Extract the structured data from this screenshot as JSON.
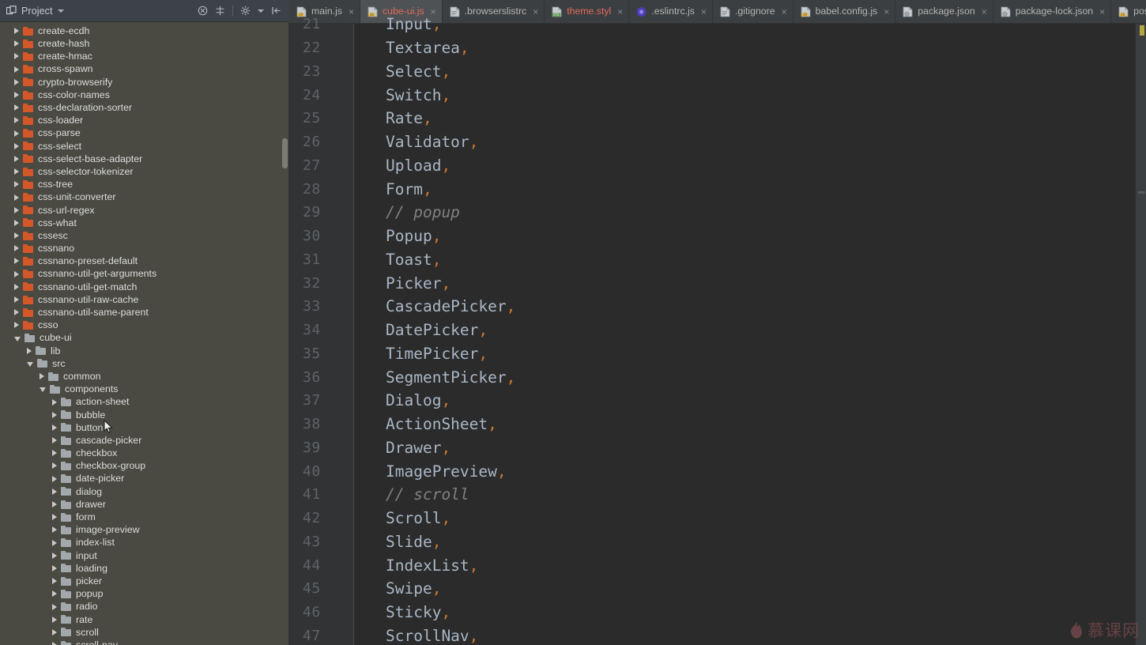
{
  "sidebar": {
    "panel_title": "Project",
    "panel_icon": "project-panel-icon",
    "header_icons": [
      {
        "name": "collapse-all-icon",
        "label": "Collapse All"
      },
      {
        "name": "locate-file-icon",
        "label": "Select Opened File"
      },
      {
        "name": "settings-gear-icon",
        "label": "Settings"
      },
      {
        "name": "hide-panel-icon",
        "label": "Hide"
      }
    ],
    "tree": [
      {
        "label": "create-ecdh",
        "indent": 1,
        "state": "closed",
        "color": "orange"
      },
      {
        "label": "create-hash",
        "indent": 1,
        "state": "closed",
        "color": "orange"
      },
      {
        "label": "create-hmac",
        "indent": 1,
        "state": "closed",
        "color": "orange"
      },
      {
        "label": "cross-spawn",
        "indent": 1,
        "state": "closed",
        "color": "orange"
      },
      {
        "label": "crypto-browserify",
        "indent": 1,
        "state": "closed",
        "color": "orange"
      },
      {
        "label": "css-color-names",
        "indent": 1,
        "state": "closed",
        "color": "orange"
      },
      {
        "label": "css-declaration-sorter",
        "indent": 1,
        "state": "closed",
        "color": "orange"
      },
      {
        "label": "css-loader",
        "indent": 1,
        "state": "closed",
        "color": "orange"
      },
      {
        "label": "css-parse",
        "indent": 1,
        "state": "closed",
        "color": "orange"
      },
      {
        "label": "css-select",
        "indent": 1,
        "state": "closed",
        "color": "orange"
      },
      {
        "label": "css-select-base-adapter",
        "indent": 1,
        "state": "closed",
        "color": "orange"
      },
      {
        "label": "css-selector-tokenizer",
        "indent": 1,
        "state": "closed",
        "color": "orange"
      },
      {
        "label": "css-tree",
        "indent": 1,
        "state": "closed",
        "color": "orange"
      },
      {
        "label": "css-unit-converter",
        "indent": 1,
        "state": "closed",
        "color": "orange"
      },
      {
        "label": "css-url-regex",
        "indent": 1,
        "state": "closed",
        "color": "orange"
      },
      {
        "label": "css-what",
        "indent": 1,
        "state": "closed",
        "color": "orange"
      },
      {
        "label": "cssesc",
        "indent": 1,
        "state": "closed",
        "color": "orange"
      },
      {
        "label": "cssnano",
        "indent": 1,
        "state": "closed",
        "color": "orange"
      },
      {
        "label": "cssnano-preset-default",
        "indent": 1,
        "state": "closed",
        "color": "orange"
      },
      {
        "label": "cssnano-util-get-arguments",
        "indent": 1,
        "state": "closed",
        "color": "orange"
      },
      {
        "label": "cssnano-util-get-match",
        "indent": 1,
        "state": "closed",
        "color": "orange"
      },
      {
        "label": "cssnano-util-raw-cache",
        "indent": 1,
        "state": "closed",
        "color": "orange"
      },
      {
        "label": "cssnano-util-same-parent",
        "indent": 1,
        "state": "closed",
        "color": "orange"
      },
      {
        "label": "csso",
        "indent": 1,
        "state": "closed",
        "color": "orange"
      },
      {
        "label": "cube-ui",
        "indent": 1,
        "state": "open",
        "color": "gray"
      },
      {
        "label": "lib",
        "indent": 2,
        "state": "closed",
        "color": "gray"
      },
      {
        "label": "src",
        "indent": 2,
        "state": "open",
        "color": "gray"
      },
      {
        "label": "common",
        "indent": 3,
        "state": "closed",
        "color": "gray"
      },
      {
        "label": "components",
        "indent": 3,
        "state": "open",
        "color": "gray"
      },
      {
        "label": "action-sheet",
        "indent": 4,
        "state": "closed",
        "color": "gray"
      },
      {
        "label": "bubble",
        "indent": 4,
        "state": "closed",
        "color": "gray"
      },
      {
        "label": "button",
        "indent": 4,
        "state": "closed",
        "color": "gray"
      },
      {
        "label": "cascade-picker",
        "indent": 4,
        "state": "closed",
        "color": "gray"
      },
      {
        "label": "checkbox",
        "indent": 4,
        "state": "closed",
        "color": "gray"
      },
      {
        "label": "checkbox-group",
        "indent": 4,
        "state": "closed",
        "color": "gray"
      },
      {
        "label": "date-picker",
        "indent": 4,
        "state": "closed",
        "color": "gray"
      },
      {
        "label": "dialog",
        "indent": 4,
        "state": "closed",
        "color": "gray"
      },
      {
        "label": "drawer",
        "indent": 4,
        "state": "closed",
        "color": "gray"
      },
      {
        "label": "form",
        "indent": 4,
        "state": "closed",
        "color": "gray"
      },
      {
        "label": "image-preview",
        "indent": 4,
        "state": "closed",
        "color": "gray"
      },
      {
        "label": "index-list",
        "indent": 4,
        "state": "closed",
        "color": "gray"
      },
      {
        "label": "input",
        "indent": 4,
        "state": "closed",
        "color": "gray"
      },
      {
        "label": "loading",
        "indent": 4,
        "state": "closed",
        "color": "gray"
      },
      {
        "label": "picker",
        "indent": 4,
        "state": "closed",
        "color": "gray"
      },
      {
        "label": "popup",
        "indent": 4,
        "state": "closed",
        "color": "gray"
      },
      {
        "label": "radio",
        "indent": 4,
        "state": "closed",
        "color": "gray"
      },
      {
        "label": "rate",
        "indent": 4,
        "state": "closed",
        "color": "gray"
      },
      {
        "label": "scroll",
        "indent": 4,
        "state": "closed",
        "color": "gray"
      },
      {
        "label": "scroll-nav",
        "indent": 4,
        "state": "closed",
        "color": "gray"
      }
    ]
  },
  "tabs": [
    {
      "label": "main.js",
      "icon": "js-file-icon",
      "active": false,
      "modified": false
    },
    {
      "label": "cube-ui.js",
      "icon": "js-file-icon",
      "active": true,
      "modified": true
    },
    {
      "label": ".browserslistrc",
      "icon": "plain-file-icon",
      "active": false,
      "modified": false
    },
    {
      "label": "theme.styl",
      "icon": "styl-file-icon",
      "active": false,
      "modified": true
    },
    {
      "label": ".eslintrc.js",
      "icon": "eslint-file-icon",
      "active": false,
      "modified": false
    },
    {
      "label": ".gitignore",
      "icon": "plain-file-icon",
      "active": false,
      "modified": false
    },
    {
      "label": "babel.config.js",
      "icon": "js-file-icon",
      "active": false,
      "modified": false
    },
    {
      "label": "package.json",
      "icon": "json-file-icon",
      "active": false,
      "modified": false
    },
    {
      "label": "package-lock.json",
      "icon": "json-file-icon",
      "active": false,
      "modified": false
    },
    {
      "label": "postcss.config.js",
      "icon": "js-file-icon",
      "active": false,
      "modified": false
    }
  ],
  "tab_close_glyph": "×",
  "editor": {
    "lines": [
      {
        "num": "21",
        "indent": "  ",
        "name": "Input",
        "punc": ",",
        "comment": null
      },
      {
        "num": "22",
        "indent": "  ",
        "name": "Textarea",
        "punc": ",",
        "comment": null
      },
      {
        "num": "23",
        "indent": "  ",
        "name": "Select",
        "punc": ",",
        "comment": null
      },
      {
        "num": "24",
        "indent": "  ",
        "name": "Switch",
        "punc": ",",
        "comment": null
      },
      {
        "num": "25",
        "indent": "  ",
        "name": "Rate",
        "punc": ",",
        "comment": null
      },
      {
        "num": "26",
        "indent": "  ",
        "name": "Validator",
        "punc": ",",
        "comment": null
      },
      {
        "num": "27",
        "indent": "  ",
        "name": "Upload",
        "punc": ",",
        "comment": null
      },
      {
        "num": "28",
        "indent": "  ",
        "name": "Form",
        "punc": ",",
        "comment": null
      },
      {
        "num": "29",
        "indent": "  ",
        "name": null,
        "punc": "",
        "comment": "// popup"
      },
      {
        "num": "30",
        "indent": "  ",
        "name": "Popup",
        "punc": ",",
        "comment": null
      },
      {
        "num": "31",
        "indent": "  ",
        "name": "Toast",
        "punc": ",",
        "comment": null
      },
      {
        "num": "32",
        "indent": "  ",
        "name": "Picker",
        "punc": ",",
        "comment": null
      },
      {
        "num": "33",
        "indent": "  ",
        "name": "CascadePicker",
        "punc": ",",
        "comment": null
      },
      {
        "num": "34",
        "indent": "  ",
        "name": "DatePicker",
        "punc": ",",
        "comment": null
      },
      {
        "num": "35",
        "indent": "  ",
        "name": "TimePicker",
        "punc": ",",
        "comment": null
      },
      {
        "num": "36",
        "indent": "  ",
        "name": "SegmentPicker",
        "punc": ",",
        "comment": null
      },
      {
        "num": "37",
        "indent": "  ",
        "name": "Dialog",
        "punc": ",",
        "comment": null
      },
      {
        "num": "38",
        "indent": "  ",
        "name": "ActionSheet",
        "punc": ",",
        "comment": null
      },
      {
        "num": "39",
        "indent": "  ",
        "name": "Drawer",
        "punc": ",",
        "comment": null
      },
      {
        "num": "40",
        "indent": "  ",
        "name": "ImagePreview",
        "punc": ",",
        "comment": null
      },
      {
        "num": "41",
        "indent": "  ",
        "name": null,
        "punc": "",
        "comment": "// scroll"
      },
      {
        "num": "42",
        "indent": "  ",
        "name": "Scroll",
        "punc": ",",
        "comment": null
      },
      {
        "num": "43",
        "indent": "  ",
        "name": "Slide",
        "punc": ",",
        "comment": null
      },
      {
        "num": "44",
        "indent": "  ",
        "name": "IndexList",
        "punc": ",",
        "comment": null
      },
      {
        "num": "45",
        "indent": "  ",
        "name": "Swipe",
        "punc": ",",
        "comment": null
      },
      {
        "num": "46",
        "indent": "  ",
        "name": "Sticky",
        "punc": ",",
        "comment": null
      },
      {
        "num": "47",
        "indent": "  ",
        "name": "ScrollNav",
        "punc": ",",
        "comment": null
      }
    ]
  },
  "watermark": {
    "text": "慕课网",
    "icon": "flame-icon"
  },
  "colors": {
    "sidebar_bg": "#4a4a42",
    "panel_header_bg": "#3c414a",
    "editor_bg": "#2b2b2b",
    "gutter_bg": "#313335",
    "tabbar_bg": "#3c3f41",
    "active_tab_bg": "#4e5254",
    "identifier": "#a9b7c6",
    "punctuation": "#cc7832",
    "comment": "#808080",
    "line_number": "#606366",
    "folder_orange": "#d4572a",
    "folder_gray": "#a3a8ac",
    "modified_tab_text": "#e06c5f",
    "watermark": "#7d4a50"
  }
}
